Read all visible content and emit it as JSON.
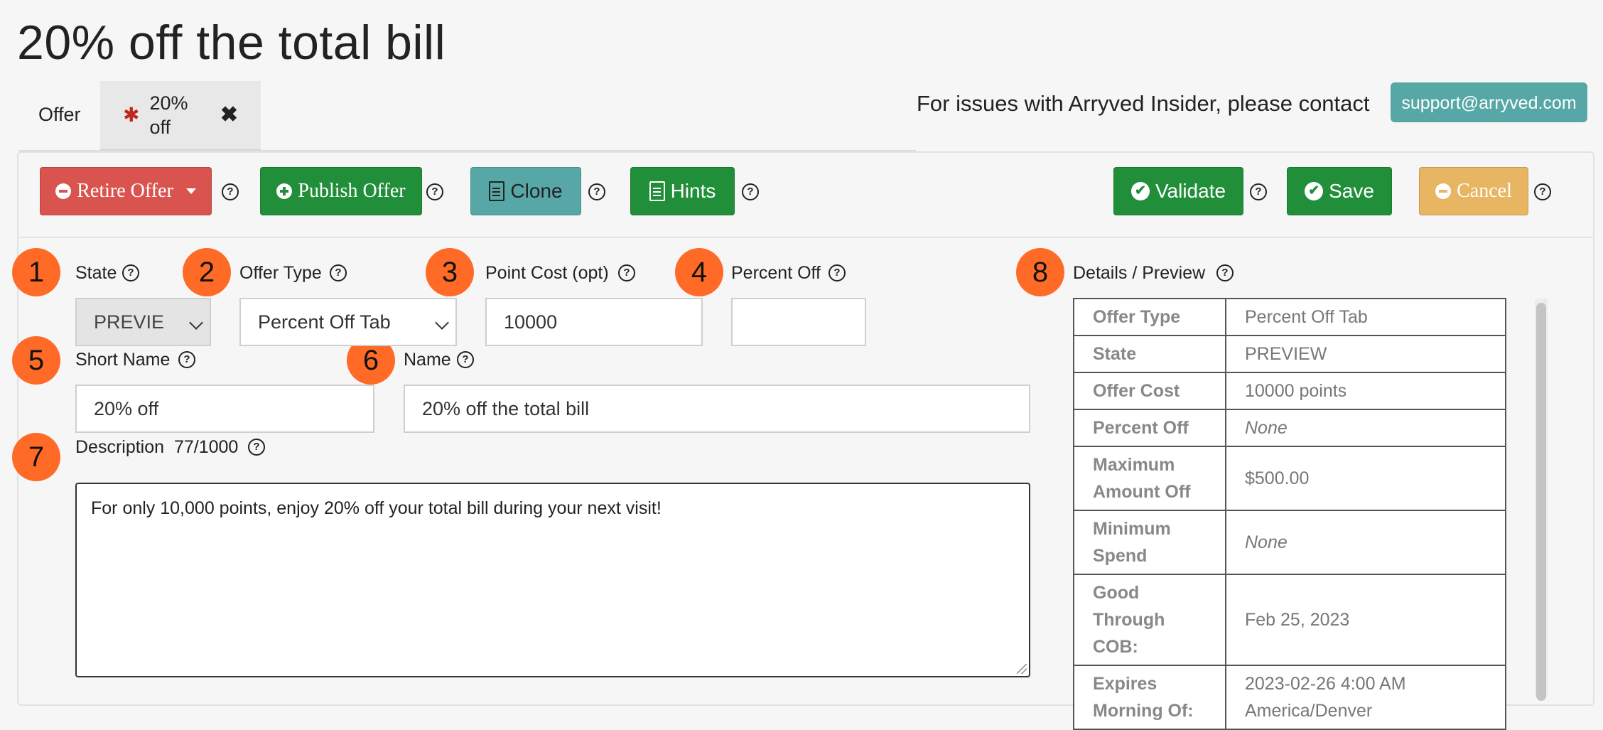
{
  "page": {
    "title": "20% off the total bill"
  },
  "tabs": {
    "offer": "Offer",
    "active": {
      "marker": "✱",
      "label": "20% off",
      "close": "✖"
    }
  },
  "support": {
    "text": "For issues with Arryved Insider, please contact",
    "email": "support@arryved.com"
  },
  "toolbar": {
    "retire": "Retire Offer",
    "publish": "Publish Offer",
    "clone": "Clone",
    "hints": "Hints",
    "validate": "Validate",
    "save": "Save",
    "cancel": "Cancel",
    "help_glyph": "?"
  },
  "badges": [
    "1",
    "2",
    "3",
    "4",
    "5",
    "6",
    "7",
    "8"
  ],
  "form": {
    "state": {
      "label": "State",
      "value": "PREVIE"
    },
    "offer_type": {
      "label": "Offer Type",
      "value": "Percent Off Tab"
    },
    "point_cost": {
      "label": "Point Cost (opt)",
      "value": "10000"
    },
    "percent_off": {
      "label": "Percent Off",
      "value": ""
    },
    "short_name": {
      "label": "Short Name",
      "value": "20% off"
    },
    "name": {
      "label": "Name",
      "value": "20% off the total bill"
    },
    "description": {
      "label": "Description",
      "count": "77/1000",
      "value": "For only 10,000 points, enjoy 20% off your total bill during your next visit!"
    }
  },
  "details": {
    "label": "Details / Preview",
    "rows": [
      {
        "key": "Offer Type",
        "value": "Percent Off Tab"
      },
      {
        "key": "State",
        "value": "PREVIEW"
      },
      {
        "key": "Offer Cost",
        "value": "10000 points"
      },
      {
        "key": "Percent Off",
        "value": "None"
      },
      {
        "key": "Maximum Amount Off",
        "value": "$500.00"
      },
      {
        "key": "Minimum Spend",
        "value": "None"
      },
      {
        "key": "Good Through COB:",
        "value": "Feb 25, 2023"
      },
      {
        "key": "Expires Morning Of:",
        "value": "2023-02-26 4:00 AM America/Denver"
      }
    ]
  },
  "colors": {
    "badge": "#ff6a26",
    "red": "#d9534f",
    "green": "#218f39",
    "teal": "#56a7a6",
    "orange": "#e8b563"
  }
}
